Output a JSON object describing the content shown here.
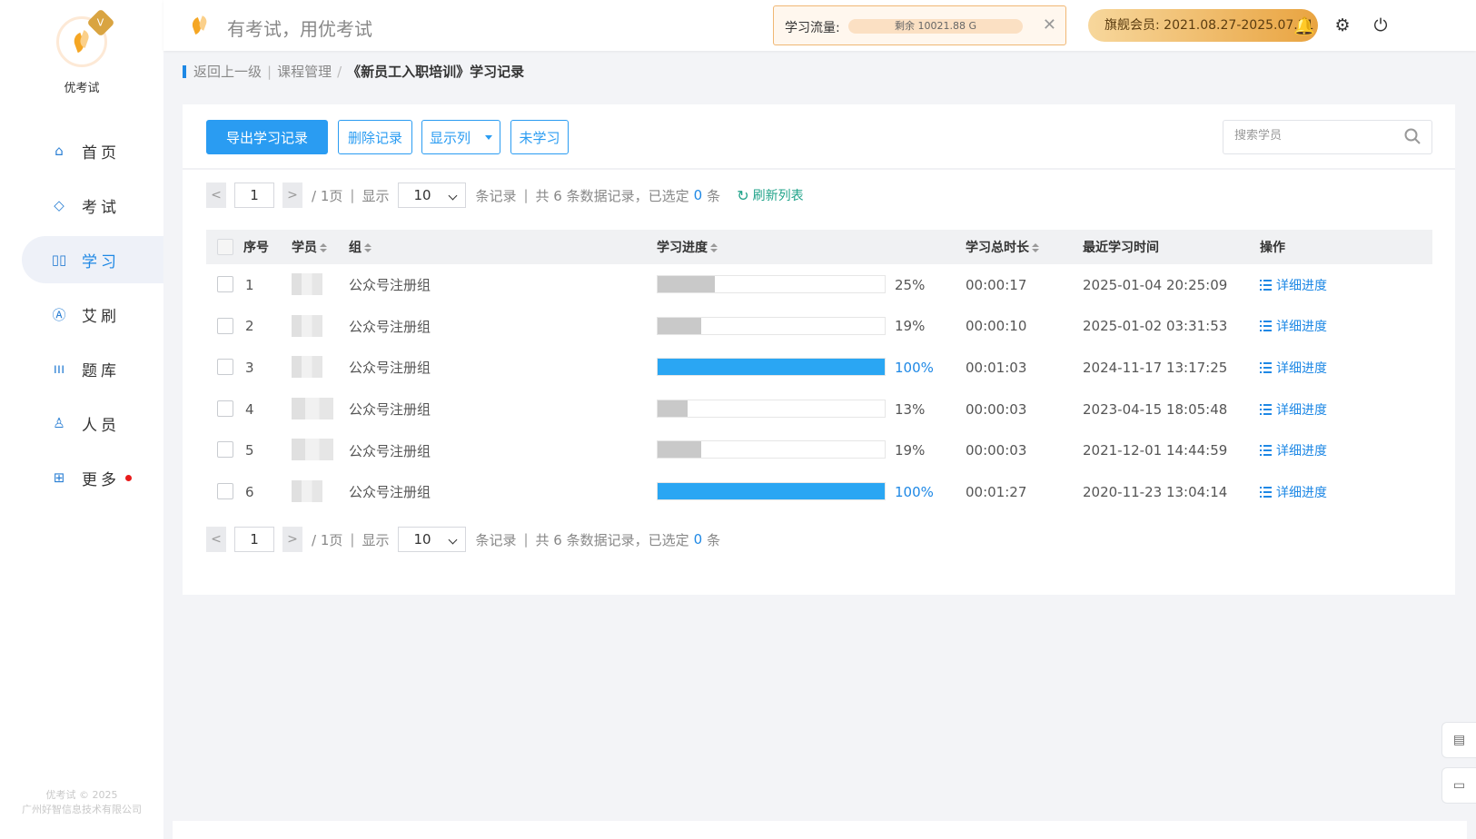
{
  "sidebar": {
    "brand": "优考试",
    "crown_glyph": "V",
    "items": [
      {
        "label": "首页",
        "icon": "home-icon",
        "glyph": "⌂",
        "active": false
      },
      {
        "label": "考试",
        "icon": "eraser-icon",
        "glyph": "◇",
        "active": false
      },
      {
        "label": "学习",
        "icon": "book-icon",
        "glyph": "▯▯",
        "active": true
      },
      {
        "label": "艾刷",
        "icon": "a-badge-icon",
        "glyph": "Ⓐ",
        "active": false
      },
      {
        "label": "题库",
        "icon": "bar-chart-icon",
        "glyph": "ııı",
        "active": false
      },
      {
        "label": "人员",
        "icon": "person-icon",
        "glyph": "♙",
        "active": false
      },
      {
        "label": "更多",
        "icon": "grid-icon",
        "glyph": "⊞",
        "active": false
      }
    ],
    "copyright_line1": "优考试 © 2025",
    "copyright_line2": "广州好智信息技术有限公司"
  },
  "topbar": {
    "slogan": "有考试，用优考试",
    "flow_label": "学习流量:",
    "flow_remaining": "剩余 10021.88 G",
    "close_glyph": "✕",
    "vip_text": "旗舰会员: 2021.08.27-2025.07.31",
    "bell_glyph": "🔔",
    "gear_glyph": "⚙",
    "power_glyph": "⏻"
  },
  "breadcrumb": {
    "back": "返回上一级",
    "course": "课程管理",
    "sep": "/",
    "divider": "|",
    "current": "《新员工入职培训》学习记录"
  },
  "toolbar": {
    "export_label": "导出学习记录",
    "delete_label": "删除记录",
    "columns_label": "显示列",
    "unlearned_label": "未学习",
    "search_placeholder": "搜索学员"
  },
  "pager": {
    "prev_glyph": "<",
    "next_glyph": ">",
    "page": "1",
    "total_pages": "/ 1页",
    "show_label": "显示",
    "page_size": "10",
    "per_label": "条记录",
    "total_text": "共 6 条数据记录，已选定",
    "selected": "0",
    "selected_unit": "条",
    "refresh_glyph": "↻",
    "refresh_label": "刷新列表"
  },
  "table": {
    "headers": {
      "index": "序号",
      "student": "学员",
      "group": "组",
      "progress": "学习进度",
      "duration": "学习总时长",
      "last_time": "最近学习时间",
      "action": "操作"
    },
    "rows": [
      {
        "index": "1",
        "group": "公众号注册组",
        "progress": 0.25,
        "progress_text": "25%",
        "duration": "00:00:17",
        "last_time": "2025-01-04 20:25:09",
        "action": "详细进度"
      },
      {
        "index": "2",
        "group": "公众号注册组",
        "progress": 0.19,
        "progress_text": "19%",
        "duration": "00:00:10",
        "last_time": "2025-01-02 03:31:53",
        "action": "详细进度"
      },
      {
        "index": "3",
        "group": "公众号注册组",
        "progress": 1.0,
        "progress_text": "100%",
        "duration": "00:01:03",
        "last_time": "2024-11-17 13:17:25",
        "action": "详细进度"
      },
      {
        "index": "4",
        "group": "公众号注册组",
        "progress": 0.13,
        "progress_text": "13%",
        "duration": "00:00:03",
        "last_time": "2023-04-15 18:05:48",
        "action": "详细进度"
      },
      {
        "index": "5",
        "group": "公众号注册组",
        "progress": 0.19,
        "progress_text": "19%",
        "duration": "00:00:03",
        "last_time": "2021-12-01 14:44:59",
        "action": "详细进度"
      },
      {
        "index": "6",
        "group": "公众号注册组",
        "progress": 1.0,
        "progress_text": "100%",
        "duration": "00:01:27",
        "last_time": "2020-11-23 13:04:14",
        "action": "详细进度"
      }
    ]
  },
  "floats": {
    "doc_glyph": "▤",
    "chat_glyph": "▭"
  },
  "colors": {
    "accent": "#2a9cf2",
    "progress_full": "#2aa6f3",
    "progress_partial": "#c9c9c9",
    "vip_start": "#f7d79c",
    "vip_end": "#e9a441",
    "refresh": "#21a38a",
    "badge_dot": "#e81b1b"
  }
}
